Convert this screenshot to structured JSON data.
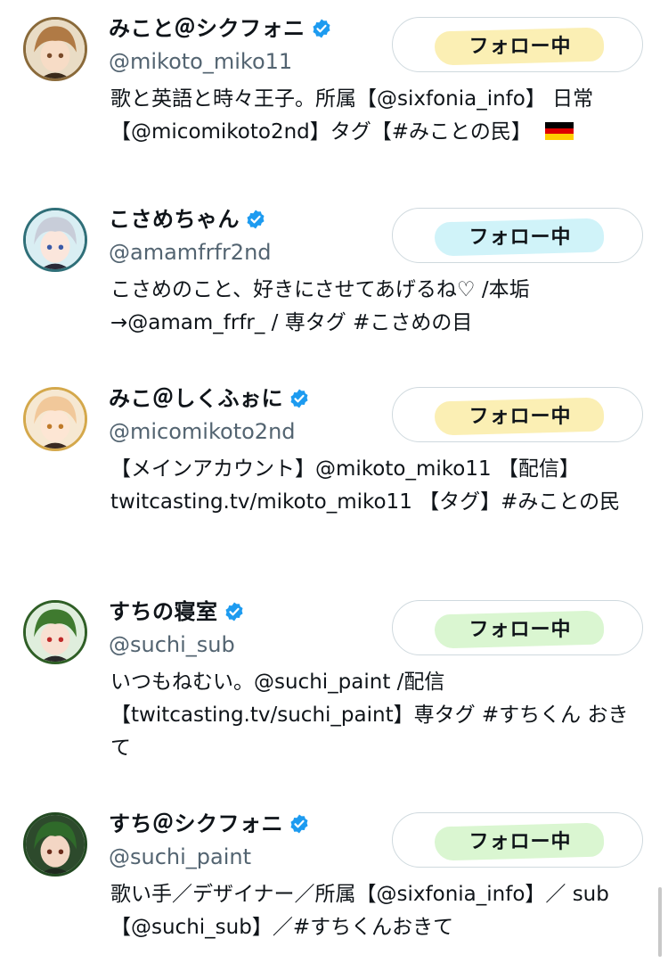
{
  "users": [
    {
      "name": "みこと＠シクフォニ",
      "handle": "@mikoto_miko11",
      "bio": "歌と英語と時々王子。所属【@sixfonia_info】 日常【@micomikoto2nd】タグ【#みことの民】",
      "follow_label": "フォロー中",
      "highlight_color": "#fbeeb0",
      "avatar_hair": "#b07a45",
      "avatar_ring": "#8a6a3a",
      "avatar_bg": "#e9dcc5"
    },
    {
      "name": "こさめちゃん",
      "handle": "@amamfrfr2nd",
      "bio": "こさめのこと、好きにさせてあげるね♡ /本垢 →@amam_frfr_ / 専タグ #こさめの目",
      "follow_label": "フォロー中",
      "highlight_color": "#cdf2f9",
      "avatar_hair": "#c8cdd9",
      "avatar_ring": "#2f6f78",
      "avatar_bg": "#d9eef3"
    },
    {
      "name": "みこ＠しくふぉに",
      "handle": "@micomikoto2nd",
      "bio": "【メインアカウント】@mikoto_miko11 【配信】 twitcasting.tv/mikoto_miko11 【タグ】#みことの民",
      "follow_label": "フォロー中",
      "highlight_color": "#fbeeb0",
      "avatar_hair": "#f1c89a",
      "avatar_ring": "#d4a84b",
      "avatar_bg": "#f6e8d2"
    },
    {
      "name": "すちの寝室",
      "handle": "@suchi_sub",
      "bio": "いつもねむい。@suchi_paint /配信 【twitcasting.tv/suchi_paint】専タグ #すちくん おきて",
      "follow_label": "フォロー中",
      "highlight_color": "#d8f5cf",
      "avatar_hair": "#3f7a2f",
      "avatar_ring": "#2f5f26",
      "avatar_bg": "#dfeedd"
    },
    {
      "name": "すち＠シクフォニ",
      "handle": "@suchi_paint",
      "bio": "歌い手／デザイナー／所属【@sixfonia_info】／ sub【@suchi_sub】／#すちくんおきて",
      "follow_label": "フォロー中",
      "highlight_color": "#d8f5cf",
      "avatar_hair": "#2f6a2a",
      "avatar_ring": "#234a22",
      "avatar_bg": "#2d4a2c"
    }
  ],
  "icons": {
    "verified": "verified-badge-icon",
    "flag": "germany-flag-icon"
  },
  "colors": {
    "verified": "#1d9bf0",
    "handle": "#536471",
    "button_border": "#cfd9de"
  }
}
